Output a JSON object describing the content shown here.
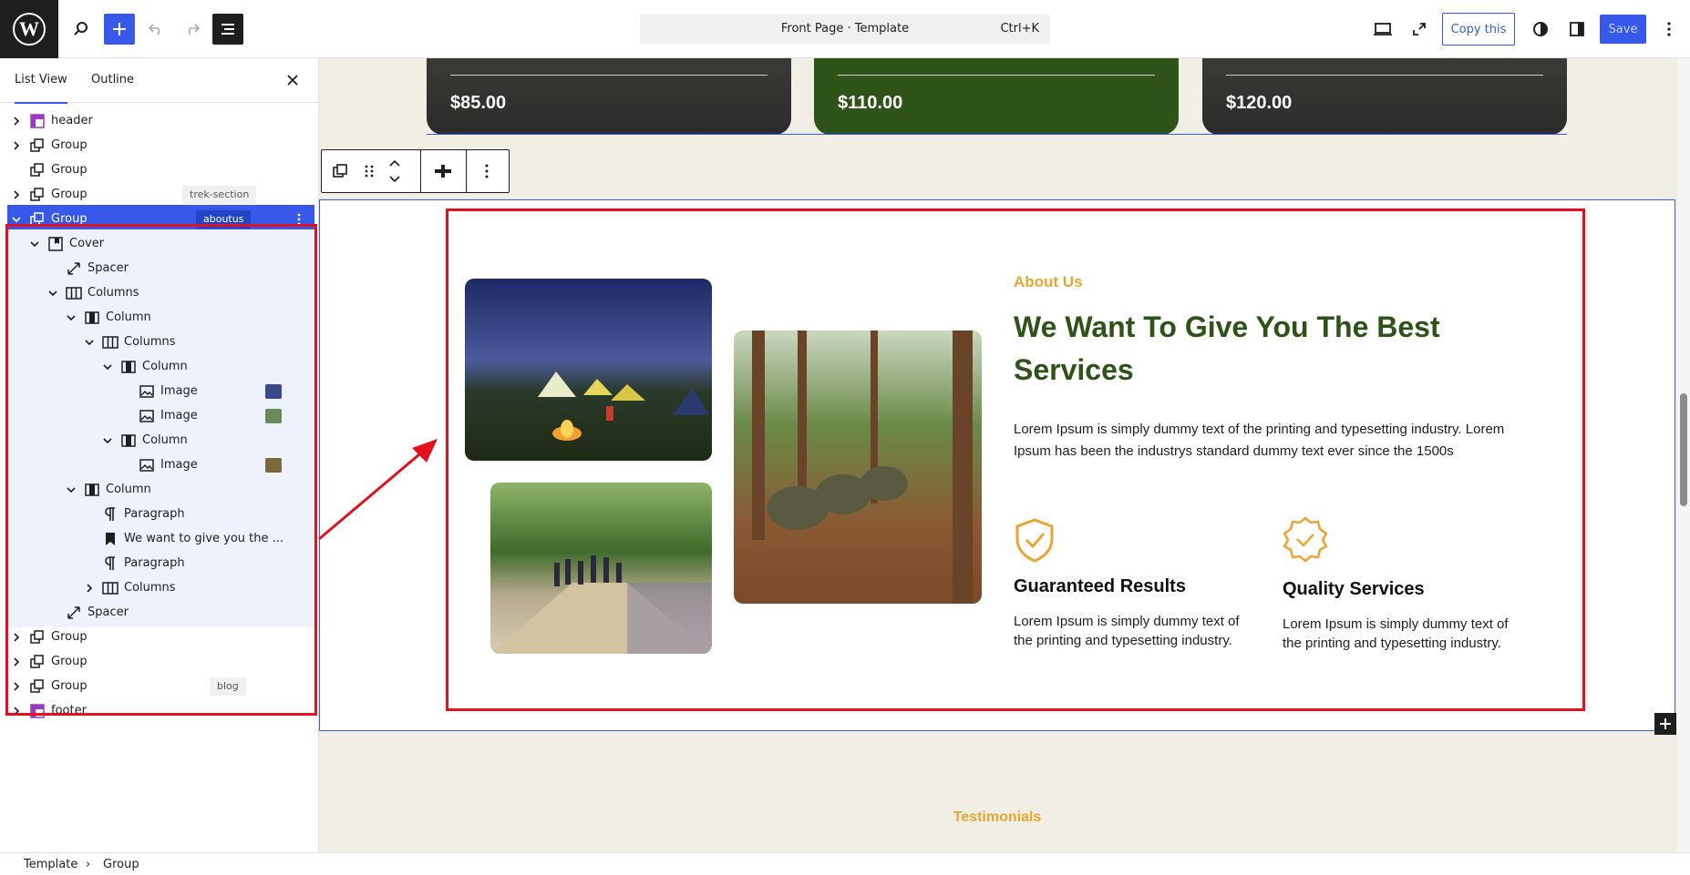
{
  "topbar": {
    "command_title": "Front Page · Template",
    "command_shortcut": "Ctrl+K",
    "copy_label": "Copy this",
    "save_label": "Save"
  },
  "sidebar": {
    "tabs": [
      "List View",
      "Outline"
    ],
    "rows": [
      {
        "label": "header"
      },
      {
        "label": "Group"
      },
      {
        "label": "Group"
      },
      {
        "label": "Group",
        "badge": "trek-section"
      },
      {
        "label": "Group",
        "badge": "aboutus"
      },
      {
        "label": "Cover"
      },
      {
        "label": "Spacer"
      },
      {
        "label": "Columns"
      },
      {
        "label": "Column"
      },
      {
        "label": "Columns"
      },
      {
        "label": "Column"
      },
      {
        "label": "Image"
      },
      {
        "label": "Image"
      },
      {
        "label": "Column"
      },
      {
        "label": "Image"
      },
      {
        "label": "Column"
      },
      {
        "label": "Paragraph"
      },
      {
        "label": "We want to give you the ..."
      },
      {
        "label": "Paragraph"
      },
      {
        "label": "Columns"
      },
      {
        "label": "Spacer"
      },
      {
        "label": "Group"
      },
      {
        "label": "Group"
      },
      {
        "label": "Group",
        "badge": "blog"
      },
      {
        "label": "footer"
      }
    ]
  },
  "breadcrumb": [
    "Template",
    "Group"
  ],
  "cards": [
    {
      "price": "$85.00"
    },
    {
      "price": "$110.00"
    },
    {
      "price": "$120.00"
    }
  ],
  "about": {
    "label": "About Us",
    "heading": "We Want To Give You The Best Services",
    "paragraph": "Lorem Ipsum is simply dummy text of the printing and typesetting industry. Lorem Ipsum has been the industrys standard dummy text ever since the 1500s",
    "features": [
      {
        "title": "Guaranteed Results",
        "text": "Lorem Ipsum is simply dummy text of the printing and typesetting industry.",
        "icon": "shield-check-icon"
      },
      {
        "title": "Quality Services",
        "text": "Lorem Ipsum is simply dummy text of the printing and typesetting industry.",
        "icon": "award-badge-icon"
      }
    ]
  },
  "testimonials_label": "Testimonials",
  "colors": {
    "accent": "#3858e9",
    "brand_green": "#2e5319",
    "brand_orange": "#e8a532",
    "highlight_red": "#e3101e"
  }
}
